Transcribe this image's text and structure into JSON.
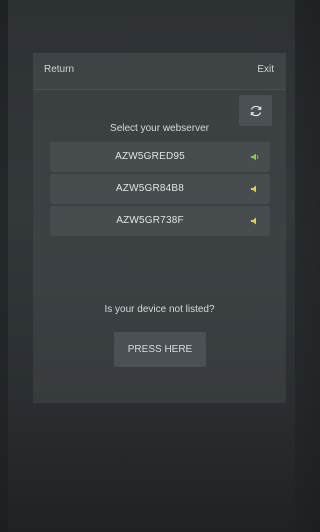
{
  "header": {
    "return_label": "Return",
    "exit_label": "Exit"
  },
  "main": {
    "title": "Select your webserver",
    "refresh_icon": "refresh-icon",
    "devices": [
      {
        "name": "AZW5GRED95",
        "signal_color": "#7fd13b"
      },
      {
        "name": "AZW5GR84B8",
        "signal_color": "#e6d23a"
      },
      {
        "name": "AZW5GR738F",
        "signal_color": "#e6d23a"
      }
    ],
    "question": "Is your device not listed?",
    "press_label": "PRESS HERE"
  }
}
